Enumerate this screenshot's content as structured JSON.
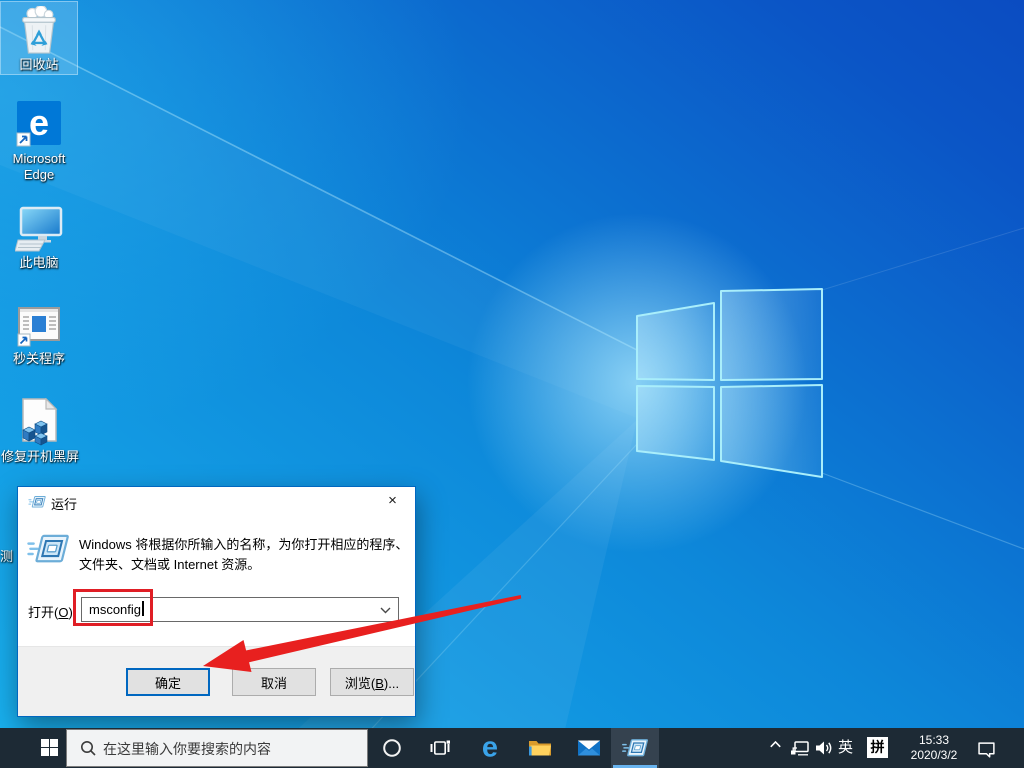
{
  "colors": {
    "accent": "#0078d7",
    "annotation_red": "#e01e25",
    "taskbar_bg": "#1d2a35",
    "desktop_selection": "rgba(150,210,245,0.32)"
  },
  "desktop": {
    "icons": [
      {
        "name": "recycle-bin",
        "label": "回收站",
        "selected": true
      },
      {
        "name": "microsoft-edge",
        "label": "Microsoft Edge",
        "label_lines": [
          "Microsoft",
          "Edge"
        ]
      },
      {
        "name": "this-pc",
        "label": "此电脑"
      },
      {
        "name": "shortcut-program",
        "label": "秒关程序"
      },
      {
        "name": "fix-boot-black-screen",
        "label": "修复开机黑屏"
      }
    ],
    "clipped_icon_label_fragment": "测"
  },
  "run_dialog": {
    "title": "运行",
    "close_glyph": "×",
    "description_line1": "Windows 将根据你所输入的名称，为你打开相应的程序、",
    "description_line2": "文件夹、文档或 Internet 资源。",
    "open_label_pre": "打开(",
    "open_label_key": "O",
    "open_label_post": "):",
    "input_value": "msconfig",
    "ok_label": "确定",
    "cancel_label": "取消",
    "browse_label_pre": "浏览(",
    "browse_label_key": "B",
    "browse_label_post": ")..."
  },
  "taskbar": {
    "search_placeholder": "在这里输入你要搜索的内容",
    "icons": [
      "start",
      "search",
      "cortana",
      "task-view",
      "edge",
      "file-explorer",
      "mail",
      "run"
    ],
    "active_app": "run",
    "tray": {
      "ime_lang": "英",
      "ime_mode": "拼",
      "time": "15:33",
      "date": "2020/3/2"
    }
  },
  "icons": {
    "edge_glyph": "e"
  }
}
